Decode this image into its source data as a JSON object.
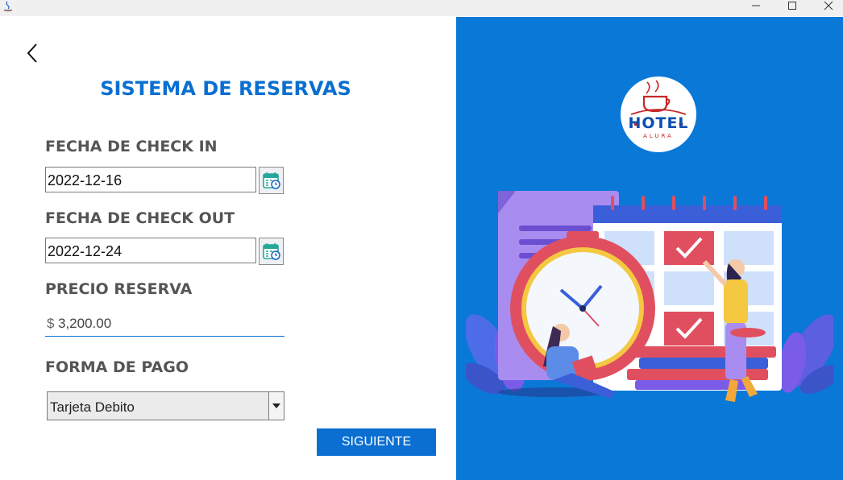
{
  "window": {
    "app_icon": "java-icon",
    "controls": [
      "minimize-icon",
      "maximize-icon",
      "close-icon"
    ]
  },
  "form": {
    "back_icon": "chevron-left-icon",
    "title": "SISTEMA DE RESERVAS",
    "checkin": {
      "label": "FECHA DE CHECK IN",
      "value": "2022-12-16",
      "icon": "calendar-icon"
    },
    "checkout": {
      "label": "FECHA DE CHECK OUT",
      "value": "2022-12-24",
      "icon": "calendar-icon"
    },
    "price": {
      "label": "PRECIO RESERVA",
      "currency": "$",
      "value": "3,200.00"
    },
    "payment": {
      "label": "FORMA DE PAGO",
      "selected": "Tarjeta Debito",
      "icon": "chevron-down-icon"
    },
    "next_button": "SIGUIENTE"
  },
  "brand": {
    "logo_word": "HOTEL",
    "logo_sub": "ALURA"
  },
  "colors": {
    "accent": "#0a6fd1",
    "panel": "#0a78d7",
    "label": "#555555"
  }
}
